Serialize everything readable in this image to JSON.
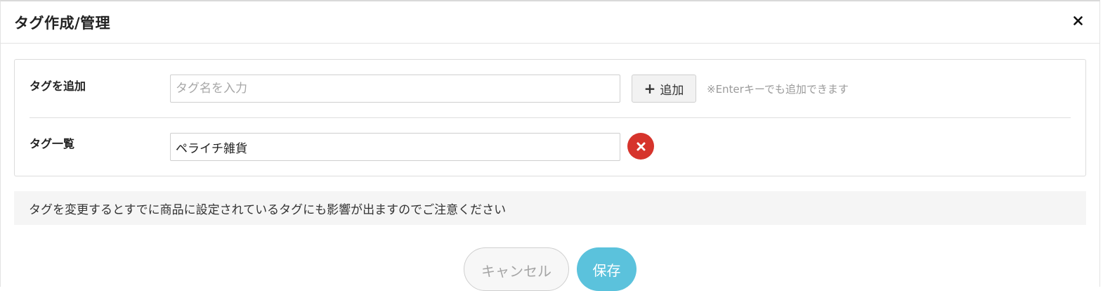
{
  "modal": {
    "title": "タグ作成/管理",
    "close_icon": "close-icon"
  },
  "add_row": {
    "label": "タグを追加",
    "input_value": "",
    "input_placeholder": "タグ名を入力",
    "add_button_label": "追加",
    "add_button_icon": "plus-icon",
    "hint": "※Enterキーでも追加できます"
  },
  "list_row": {
    "label": "タグ一覧",
    "tags": [
      {
        "value": "ペライチ雑貨",
        "remove_icon": "remove-icon"
      }
    ]
  },
  "notice": {
    "text": "タグを変更するとすでに商品に設定されているタグにも影響が出ますのでご注意ください"
  },
  "footer": {
    "cancel_label": "キャンセル",
    "save_label": "保存"
  },
  "colors": {
    "accent": "#5bc2dc",
    "danger": "#d6342c",
    "notice_bg": "#f5f5f5"
  }
}
